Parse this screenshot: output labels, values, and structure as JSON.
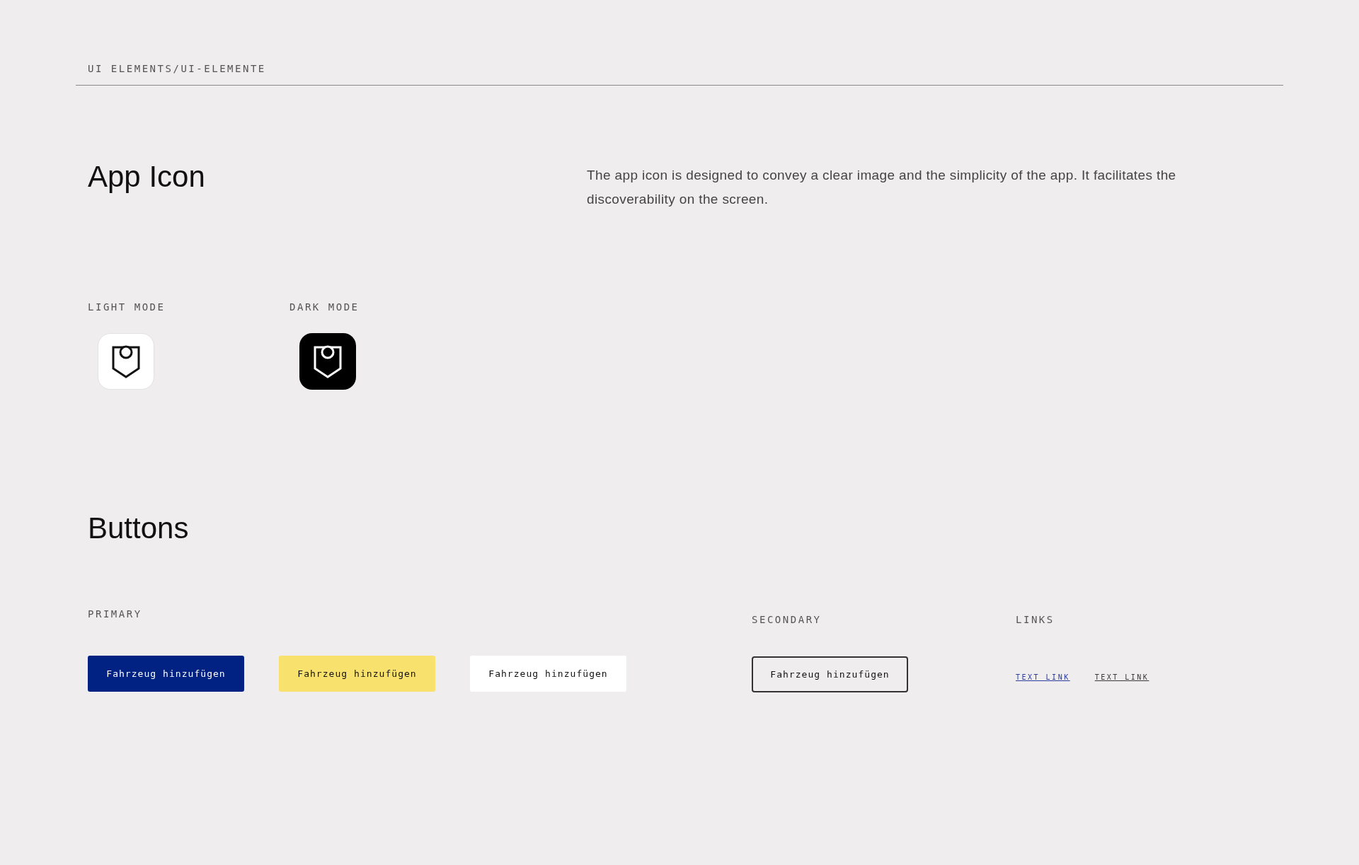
{
  "header": {
    "title": "UI ELEMENTS/UI-ELEMENTE"
  },
  "app_icon": {
    "title": "App Icon",
    "description": "The app icon is designed to convey a clear image and the simplicity of the app. It facilitates the discoverability on the screen.",
    "variants": [
      {
        "label": "LIGHT MODE",
        "kind": "light"
      },
      {
        "label": "DARK MODE",
        "kind": "dark"
      }
    ]
  },
  "buttons": {
    "title": "Buttons",
    "primary": {
      "label": "PRIMARY",
      "items": [
        {
          "label": "Fahrzeug hinzufügen",
          "kind": "blue"
        },
        {
          "label": "Fahrzeug hinzufügen",
          "kind": "yellow"
        },
        {
          "label": "Fahrzeug hinzufügen",
          "kind": "white"
        }
      ]
    },
    "secondary": {
      "label": "SECONDARY",
      "items": [
        {
          "label": "Fahrzeug hinzufügen",
          "kind": "outline"
        }
      ]
    },
    "links": {
      "label": "LINKS",
      "items": [
        {
          "label": "TEXT LINK",
          "color": "#2b3ea0"
        },
        {
          "label": "TEXT LINK",
          "color": "#3a3a3a"
        }
      ]
    }
  }
}
